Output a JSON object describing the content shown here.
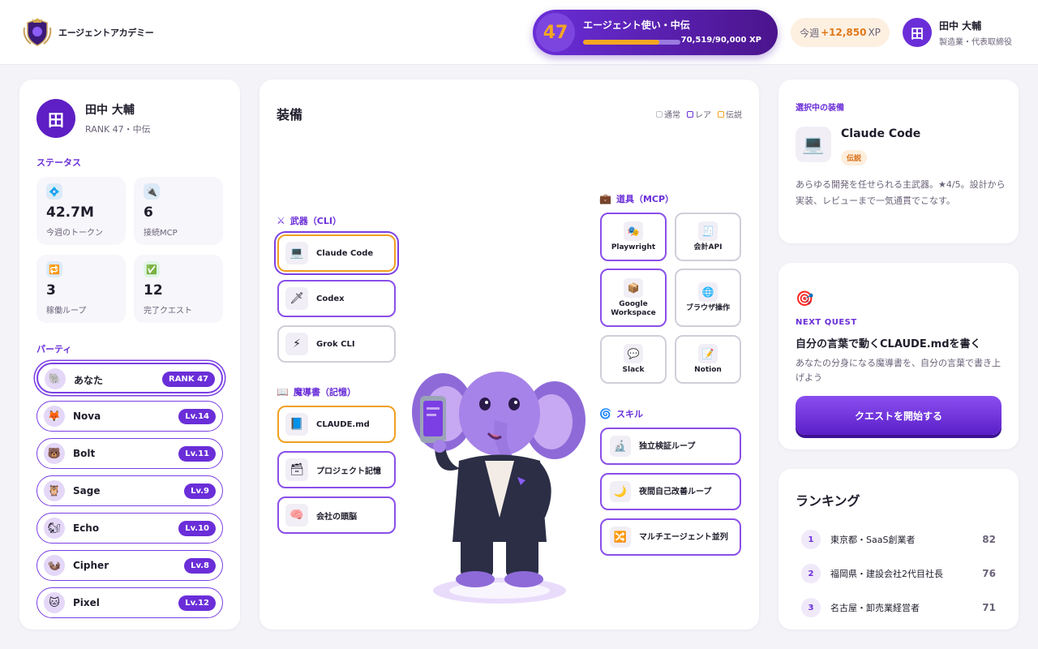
{
  "header": {
    "brand": "エージェントアカデミー",
    "level": "47",
    "level_title": "エージェント使い・中伝",
    "xp_text": "70,519/90,000 XP",
    "xp_progress": 0.78,
    "week_label": "今週",
    "week_value": "+12,850",
    "week_unit": "XP",
    "user_initial": "田",
    "user_name": "田中 大輔",
    "user_role": "製造業・代表取締役"
  },
  "profile": {
    "initial": "田",
    "name": "田中 大輔",
    "rank": "RANK 47・中伝"
  },
  "status": {
    "label": "ステータス",
    "cards": [
      {
        "icon": "💠",
        "value": "42.7M",
        "label": "今週のトークン"
      },
      {
        "icon": "🔌",
        "value": "6",
        "label": "接続MCP"
      },
      {
        "icon": "🔁",
        "value": "3",
        "label": "稼働ループ"
      },
      {
        "icon": "✅",
        "value": "12",
        "label": "完了クエスト"
      }
    ]
  },
  "party": {
    "label": "パーティ",
    "members": [
      {
        "icon": "🐘",
        "name": "あなた",
        "level": "RANK 47"
      },
      {
        "icon": "🦊",
        "name": "Nova",
        "level": "Lv.14"
      },
      {
        "icon": "🐻",
        "name": "Bolt",
        "level": "Lv.11"
      },
      {
        "icon": "🦉",
        "name": "Sage",
        "level": "Lv.9"
      },
      {
        "icon": "🐿",
        "name": "Echo",
        "level": "Lv.10"
      },
      {
        "icon": "🦦",
        "name": "Cipher",
        "level": "Lv.8"
      },
      {
        "icon": "🐱",
        "name": "Pixel",
        "level": "Lv.12"
      }
    ]
  },
  "equipment": {
    "title": "装備",
    "legend": {
      "normal": "通常",
      "rare": "レア",
      "legendary": "伝説"
    },
    "weapons": {
      "label": "武器（CLI）",
      "icon": "⚔",
      "items": [
        {
          "icon": "💻",
          "label": "Claude Code"
        },
        {
          "icon": "🗡",
          "label": "Codex"
        },
        {
          "icon": "⚡",
          "label": "Grok CLI"
        }
      ]
    },
    "grimoire": {
      "label": "魔導書（記憶）",
      "icon": "📖",
      "items": [
        {
          "icon": "📘",
          "label": "CLAUDE.md"
        },
        {
          "icon": "🗃",
          "label": "プロジェクト記憶"
        },
        {
          "icon": "🧠",
          "label": "会社の頭脳"
        }
      ]
    },
    "tools": {
      "label": "道具（MCP）",
      "icon": "💼",
      "items": [
        {
          "icon": "🎭",
          "label": "Playwright"
        },
        {
          "icon": "🧾",
          "label": "会計API"
        },
        {
          "icon": "📦",
          "label": "Google Workspace"
        },
        {
          "icon": "🌐",
          "label": "ブラウザ操作"
        },
        {
          "icon": "💬",
          "label": "Slack"
        },
        {
          "icon": "📝",
          "label": "Notion"
        }
      ]
    },
    "skills": {
      "label": "スキル",
      "icon": "🌀",
      "items": [
        {
          "icon": "🔬",
          "label": "独立検証ループ"
        },
        {
          "icon": "🌙",
          "label": "夜間自己改善ループ"
        },
        {
          "icon": "🔀",
          "label": "マルチエージェント並列"
        }
      ]
    }
  },
  "selected": {
    "title": "選択中の装備",
    "icon": "💻",
    "name": "Claude Code",
    "rarity": "伝説",
    "description": "あらゆる開発を任せられる主武器。★4/5。設計から実装、レビューまで一気通貫でこなす。"
  },
  "quest": {
    "icon": "🎯",
    "tag": "NEXT QUEST",
    "title": "自分の言葉で動くCLAUDE.mdを書く",
    "description": "あなたの分身になる魔導書を、自分の言葉で書き上げよう",
    "button": "クエストを開始する"
  },
  "ranking": {
    "title": "ランキング",
    "rows": [
      {
        "rank": "1",
        "name": "東京都・SaaS創業者",
        "score": "82"
      },
      {
        "rank": "2",
        "name": "福岡県・建設会社2代目社長",
        "score": "76"
      },
      {
        "rank": "3",
        "name": "名古屋・卸売業経営者",
        "score": "71"
      }
    ]
  },
  "colors": {
    "accent": "#6a2ed8",
    "legendary": "#f0a020",
    "background": "#f4f3f8"
  }
}
